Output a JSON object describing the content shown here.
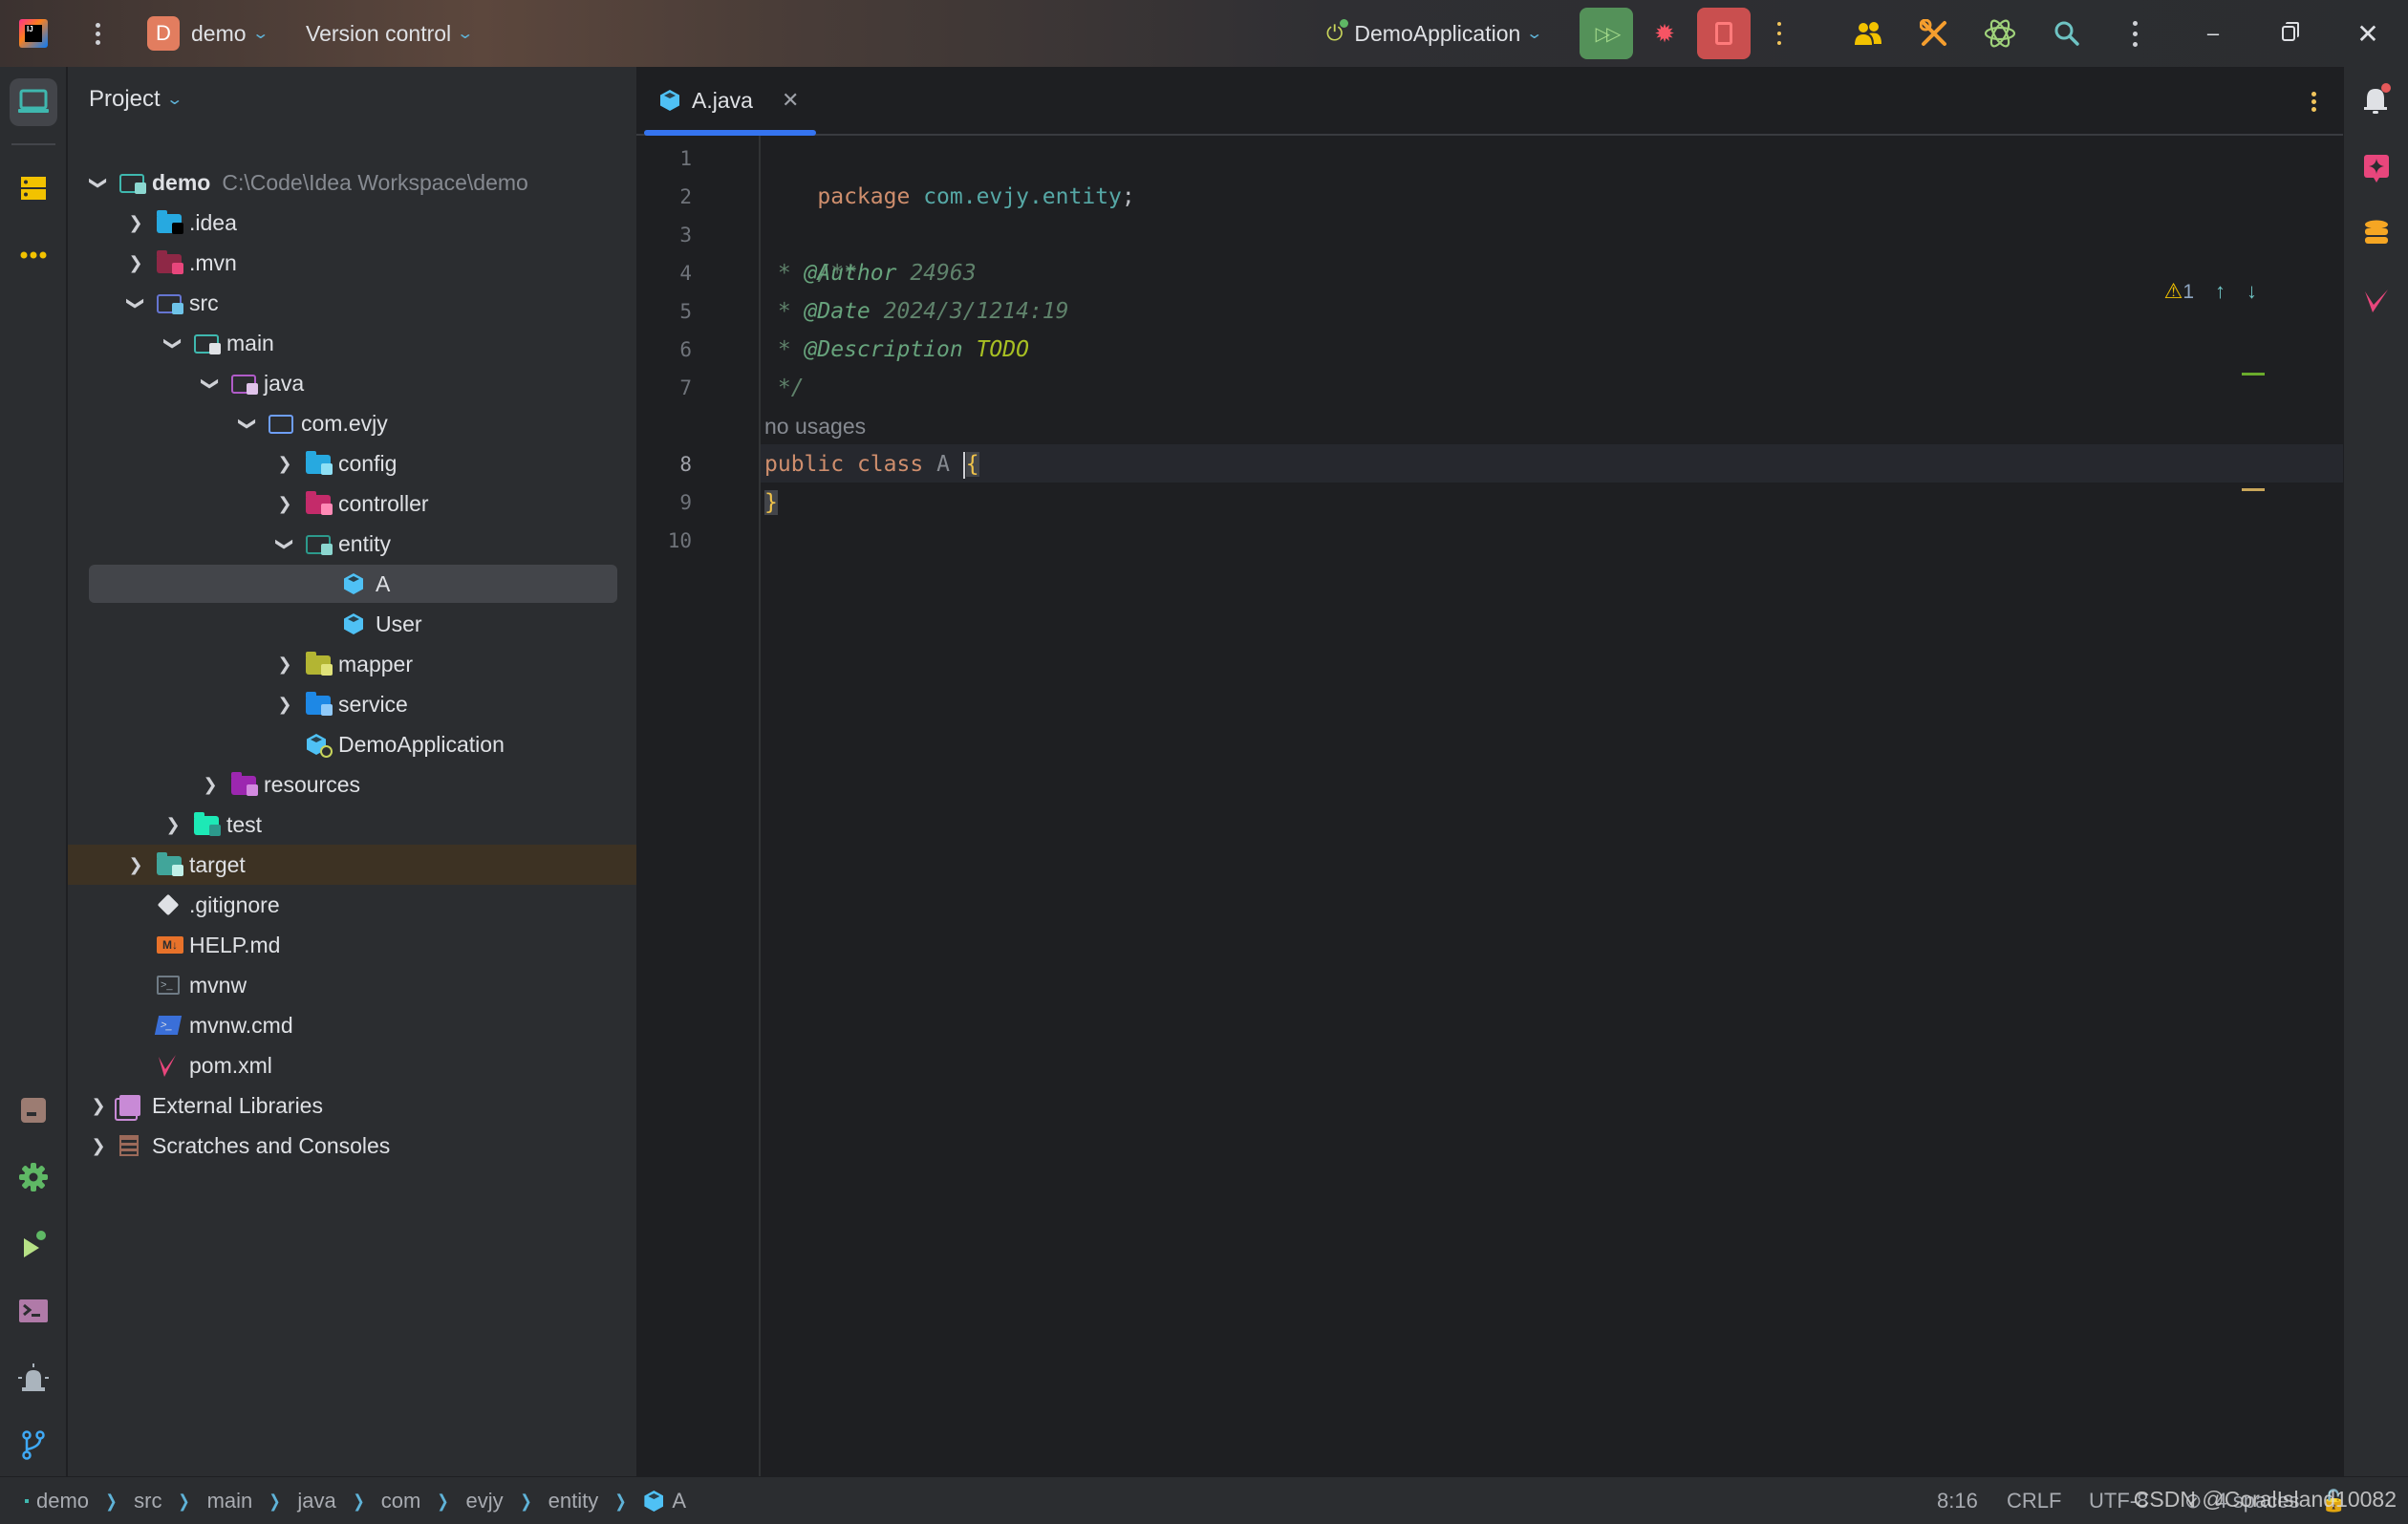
{
  "titlebar": {
    "project_badge": "D",
    "project_name": "demo",
    "version_control": "Version control",
    "run_config": "DemoApplication"
  },
  "project_panel": {
    "title": "Project",
    "tree": [
      {
        "label": "demo",
        "detail": "C:\\Code\\Idea Workspace\\demo",
        "depth": 0,
        "expanded": true,
        "icon": "module-folder-icon"
      },
      {
        "label": ".idea",
        "depth": 1,
        "expanded": false,
        "icon": "idea-folder-icon"
      },
      {
        "label": ".mvn",
        "depth": 1,
        "expanded": false,
        "icon": "maven-folder-icon"
      },
      {
        "label": "src",
        "depth": 1,
        "expanded": true,
        "icon": "source-folder-icon"
      },
      {
        "label": "main",
        "depth": 2,
        "expanded": true,
        "icon": "main-folder-icon"
      },
      {
        "label": "java",
        "depth": 3,
        "expanded": true,
        "icon": "java-source-root-icon"
      },
      {
        "label": "com.evjy",
        "depth": 4,
        "expanded": true,
        "icon": "package-icon"
      },
      {
        "label": "config",
        "depth": 5,
        "expanded": false,
        "icon": "config-folder-icon"
      },
      {
        "label": "controller",
        "depth": 5,
        "expanded": false,
        "icon": "controller-folder-icon"
      },
      {
        "label": "entity",
        "depth": 5,
        "expanded": true,
        "icon": "entity-folder-icon"
      },
      {
        "label": "A",
        "depth": 6,
        "icon": "java-class-icon",
        "selected": true
      },
      {
        "label": "User",
        "depth": 6,
        "icon": "java-class-icon"
      },
      {
        "label": "mapper",
        "depth": 5,
        "expanded": false,
        "icon": "mapper-folder-icon"
      },
      {
        "label": "service",
        "depth": 5,
        "expanded": false,
        "icon": "service-folder-icon"
      },
      {
        "label": "DemoApplication",
        "depth": 5,
        "icon": "spring-boot-class-icon"
      },
      {
        "label": "resources",
        "depth": 3,
        "expanded": false,
        "icon": "resources-folder-icon"
      },
      {
        "label": "test",
        "depth": 2,
        "expanded": false,
        "icon": "test-folder-icon"
      },
      {
        "label": "target",
        "depth": 1,
        "expanded": false,
        "icon": "target-folder-icon",
        "excluded": true
      },
      {
        "label": ".gitignore",
        "depth": 1,
        "icon": "git-icon"
      },
      {
        "label": "HELP.md",
        "depth": 1,
        "icon": "markdown-icon"
      },
      {
        "label": "mvnw",
        "depth": 1,
        "icon": "shell-script-icon"
      },
      {
        "label": "mvnw.cmd",
        "depth": 1,
        "icon": "powershell-icon"
      },
      {
        "label": "pom.xml",
        "depth": 1,
        "icon": "maven-icon"
      },
      {
        "label": "External Libraries",
        "depth": 0,
        "expanded": false,
        "icon": "library-icon"
      },
      {
        "label": "Scratches and Consoles",
        "depth": 0,
        "expanded": false,
        "icon": "scratches-icon"
      }
    ]
  },
  "editor": {
    "tab_label": "A.java",
    "inspection_warnings": "1",
    "inlay_hint": "no usages",
    "current_line": 8,
    "line_numbers": [
      "1",
      "2",
      "3",
      "4",
      "5",
      "6",
      "7",
      "8",
      "9",
      "10"
    ],
    "code": {
      "l1_kw": "package",
      "l1_pkg": "com.evjy.entity",
      "l1_semi": ";",
      "l3": "/**",
      "l4_star": " * ",
      "l4_tag": "@Author",
      "l4_val": " 24963",
      "l5_star": " * ",
      "l5_tag": "@Date",
      "l5_val": " 2024/3/1214:19",
      "l6_star": " * ",
      "l6_tag": "@Description",
      "l6_val": "TODO",
      "l7": " */",
      "l8_kw1": "public",
      "l8_kw2": "class",
      "l8_name": "A",
      "l8_brace": "{",
      "l9_brace": "}"
    }
  },
  "statusbar": {
    "breadcrumbs": [
      "demo",
      "src",
      "main",
      "java",
      "com",
      "evjy",
      "entity",
      "A"
    ],
    "caret_position": "8:16",
    "line_separator": "CRLF",
    "encoding": "UTF-8",
    "indent": "4 spaces",
    "watermark": "CSDN @CoralIsland10082"
  },
  "colors": {
    "accent": "#3574f0",
    "run_button": "#549159",
    "stop_button": "#c94f4f",
    "project_badge": "#e27d5f"
  }
}
